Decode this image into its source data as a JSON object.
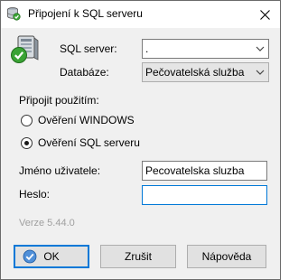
{
  "window": {
    "title": "Připojení k SQL serveru"
  },
  "icons": {
    "app": "database-icon",
    "close": "close-icon",
    "server": "sql-server-connected-icon",
    "ok": "checkmark-circle-icon",
    "dropdown": "chevron-down-icon"
  },
  "form": {
    "server_label": "SQL server:",
    "server_value": ".",
    "database_label": "Databáze:",
    "database_value": "Pečovatelská služba",
    "connect_using_label": "Připojit použitím:",
    "auth_options": [
      {
        "label": "Ověření WINDOWS",
        "selected": false
      },
      {
        "label": "Ověření SQL serveru",
        "selected": true
      }
    ],
    "username_label": "Jméno uživatele:",
    "username_value": "Pecovatelska sluzba",
    "password_label": "Heslo:",
    "password_value": ""
  },
  "version": "Verze 5.44.0",
  "buttons": {
    "ok": "OK",
    "cancel": "Zrušit",
    "help": "Nápověda"
  },
  "colors": {
    "accent": "#0078d7",
    "success_green": "#3aa335",
    "dialog_bg": "#f0f0f0"
  }
}
